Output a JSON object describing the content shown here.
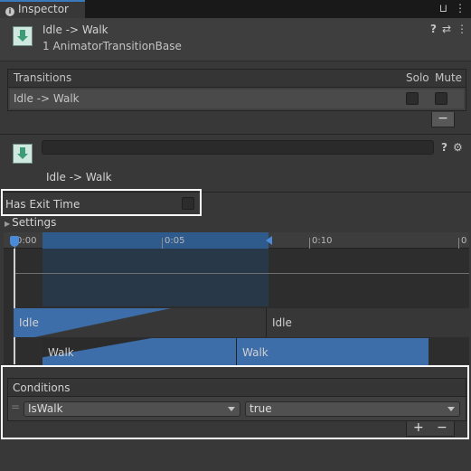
{
  "tab": {
    "title": "Inspector",
    "info_glyph": "i",
    "lock_glyph": "🔒",
    "menu_glyph": "⋮"
  },
  "header": {
    "title": "Idle -> Walk",
    "subtitle": "1 AnimatorTransitionBase",
    "help_glyph": "?",
    "settings_glyph": "⇄",
    "more_glyph": "⋮"
  },
  "transitions": {
    "header": "Transitions",
    "solo_label": "Solo",
    "mute_label": "Mute",
    "rows": [
      {
        "label": "Idle -> Walk",
        "solo": false,
        "mute": false
      }
    ],
    "remove_label": "−"
  },
  "transition": {
    "name_value": "",
    "title": "Idle -> Walk",
    "help_glyph": "?",
    "gear_glyph": "⚙"
  },
  "exit": {
    "label": "Has Exit Time",
    "checked": false
  },
  "settings": {
    "label": "Settings",
    "arrow": "▶"
  },
  "timeline": {
    "ticks": [
      "0:00",
      "0:05",
      "0:10",
      "0"
    ],
    "bars": {
      "idle_a": "Idle",
      "idle_b": "Idle",
      "walk_a": "Walk",
      "walk_b": "Walk"
    }
  },
  "conditions": {
    "header": "Conditions",
    "handle_glyph": "=",
    "parameter": "IsWalk",
    "value": "true",
    "add_label": "+",
    "remove_label": "−"
  },
  "colors": {
    "accent": "#3a79bb",
    "highlight": "#ffffff",
    "range_blue": "#2e5a8c",
    "walk_blue": "#3d6ea9"
  }
}
